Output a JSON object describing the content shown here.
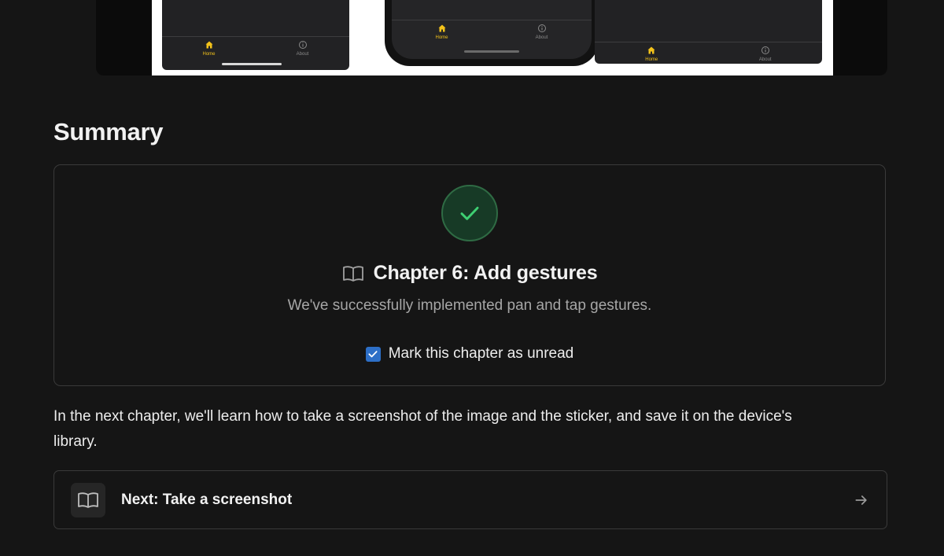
{
  "hero": {
    "tabs": {
      "home_label": "Home",
      "about_label": "About"
    }
  },
  "summary": {
    "heading": "Summary",
    "chapter_title": "Chapter 6: Add gestures",
    "description": "We've successfully implemented pan and tap gestures.",
    "mark_label": "Mark this chapter as unread",
    "mark_checked": true
  },
  "next_paragraph": "In the next chapter, we'll learn how to take a screenshot of the image and the sticker, and save it on the device's library.",
  "next_link": {
    "label": "Next: Take a screenshot"
  },
  "colors": {
    "background": "#151515",
    "success": "#3ecf72",
    "checkbox": "#2d6fc7",
    "tab_active": "#f3c21a"
  },
  "icons": [
    "home-icon",
    "info-icon",
    "checkmark-icon",
    "book-icon",
    "arrow-right-icon"
  ]
}
